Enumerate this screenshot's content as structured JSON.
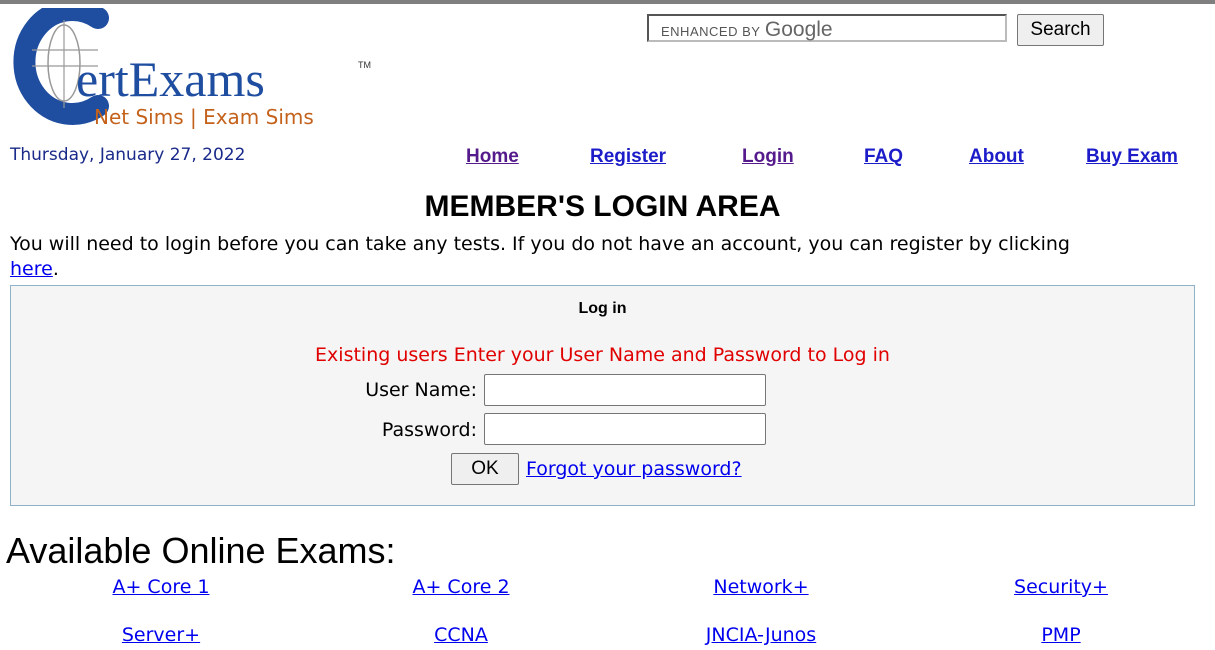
{
  "logo": {
    "brand_text": "ertExams",
    "trademark": "TM",
    "tagline": "Net Sims | Exam Sims",
    "colors": {
      "brand_blue": "#1f4ea0",
      "tagline_orange": "#c4621c"
    }
  },
  "search": {
    "watermark_prefix": "ENHANCED BY",
    "watermark_brand": "Google",
    "value": "",
    "button_label": "Search"
  },
  "date": "Thursday, January 27, 2022",
  "nav": {
    "home": "Home",
    "register": "Register",
    "login": "Login",
    "faq": "FAQ",
    "about": "About",
    "buy_exam": "Buy Exam"
  },
  "page_title": "MEMBER'S LOGIN AREA",
  "intro": {
    "text": "You will need to login before you can take any tests. If you do not have an account, you can register by clicking",
    "link_text": "here",
    "suffix": "."
  },
  "login": {
    "heading": "Log in",
    "message": "Existing users Enter your User Name and Password to Log in",
    "username_label": "User Name:",
    "username_value": "",
    "password_label": "Password:",
    "password_value": "",
    "ok_label": "OK",
    "forgot_label": "Forgot your password?"
  },
  "exams": {
    "heading": "Available Online Exams:",
    "row1": [
      "A+ Core 1",
      "A+ Core 2",
      "Network+",
      "Security+"
    ],
    "row2": [
      "Server+",
      "CCNA",
      "JNCIA-Junos",
      "PMP"
    ]
  },
  "colors": {
    "link": "#0000ee",
    "visited_link": "#551a8b",
    "nav_link": "#1c1cc9",
    "date_text": "#1a2a8a",
    "error_red": "#e00000",
    "panel_border": "#8fb2c9",
    "panel_bg": "#f5f5f5"
  }
}
